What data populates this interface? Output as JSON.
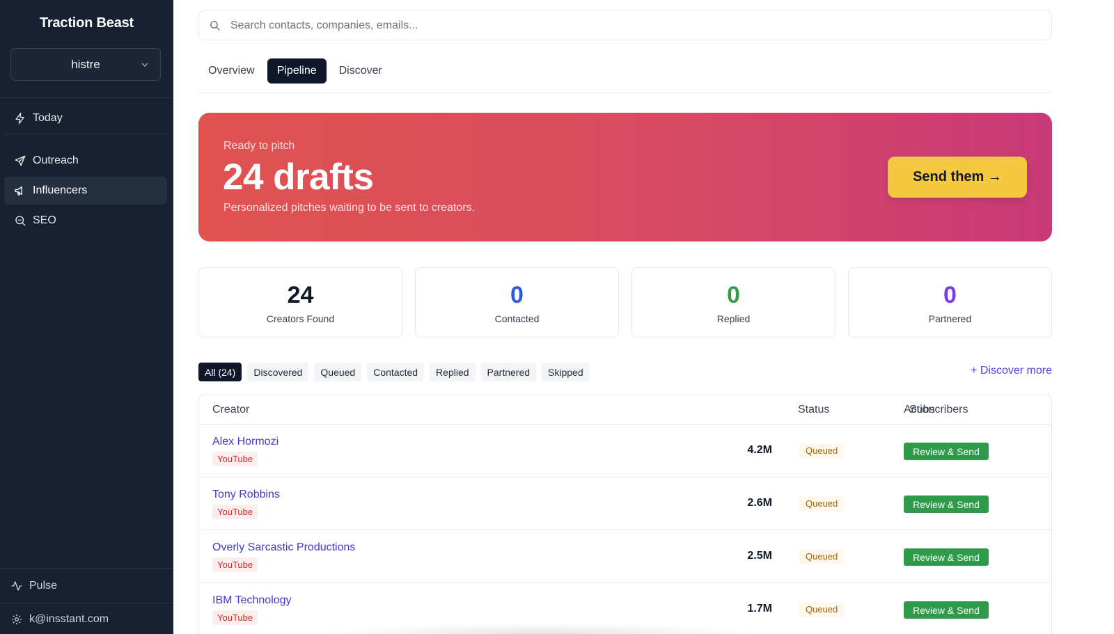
{
  "app": {
    "brand": "Traction Beast",
    "workspace": "histre"
  },
  "sidebar": {
    "today": {
      "label": "Today",
      "icon": "bolt-icon"
    },
    "items": [
      {
        "label": "Outreach",
        "icon": "send-icon"
      },
      {
        "label": "Influencers",
        "icon": "megaphone-icon",
        "active": true
      },
      {
        "label": "SEO",
        "icon": "search-zoom-icon"
      }
    ],
    "pulse": {
      "label": "Pulse",
      "icon": "activity-icon"
    },
    "account": {
      "label": "k@insstant.com",
      "icon": "gear-icon"
    }
  },
  "search": {
    "placeholder": "Search contacts, companies, emails..."
  },
  "tabs": [
    {
      "label": "Overview"
    },
    {
      "label": "Pipeline",
      "active": true
    },
    {
      "label": "Discover"
    }
  ],
  "hero": {
    "kicker": "Ready to pitch",
    "title": "24 drafts",
    "subtitle": "Personalized pitches waiting to be sent to creators.",
    "button": "Send them →",
    "button_color": "#f5c842"
  },
  "stats": [
    {
      "value": "24",
      "label": "Creators Found",
      "color": "#111827"
    },
    {
      "value": "0",
      "label": "Contacted",
      "color": "#2b59d9"
    },
    {
      "value": "0",
      "label": "Replied",
      "color": "#3a9a4a"
    },
    {
      "value": "0",
      "label": "Partnered",
      "color": "#7c3aed"
    }
  ],
  "filters": [
    "All (24)",
    "Discovered",
    "Queued",
    "Contacted",
    "Replied",
    "Partnered",
    "Skipped"
  ],
  "discover_more": "+ Discover more",
  "table": {
    "headers": {
      "creator": "Creator",
      "subscribers": "Subscribers",
      "status": "Status",
      "action": "Action"
    },
    "rows": [
      {
        "name": "Alex Hormozi",
        "platform": "YouTube",
        "subscribers": "4.2M",
        "status": "Queued",
        "action": "Review & Send"
      },
      {
        "name": "Tony Robbins",
        "platform": "YouTube",
        "subscribers": "2.6M",
        "status": "Queued",
        "action": "Review & Send"
      },
      {
        "name": "Overly Sarcastic Productions",
        "platform": "YouTube",
        "subscribers": "2.5M",
        "status": "Queued",
        "action": "Review & Send"
      },
      {
        "name": "IBM Technology",
        "platform": "YouTube",
        "subscribers": "1.7M",
        "status": "Queued",
        "action": "Review & Send"
      }
    ]
  }
}
